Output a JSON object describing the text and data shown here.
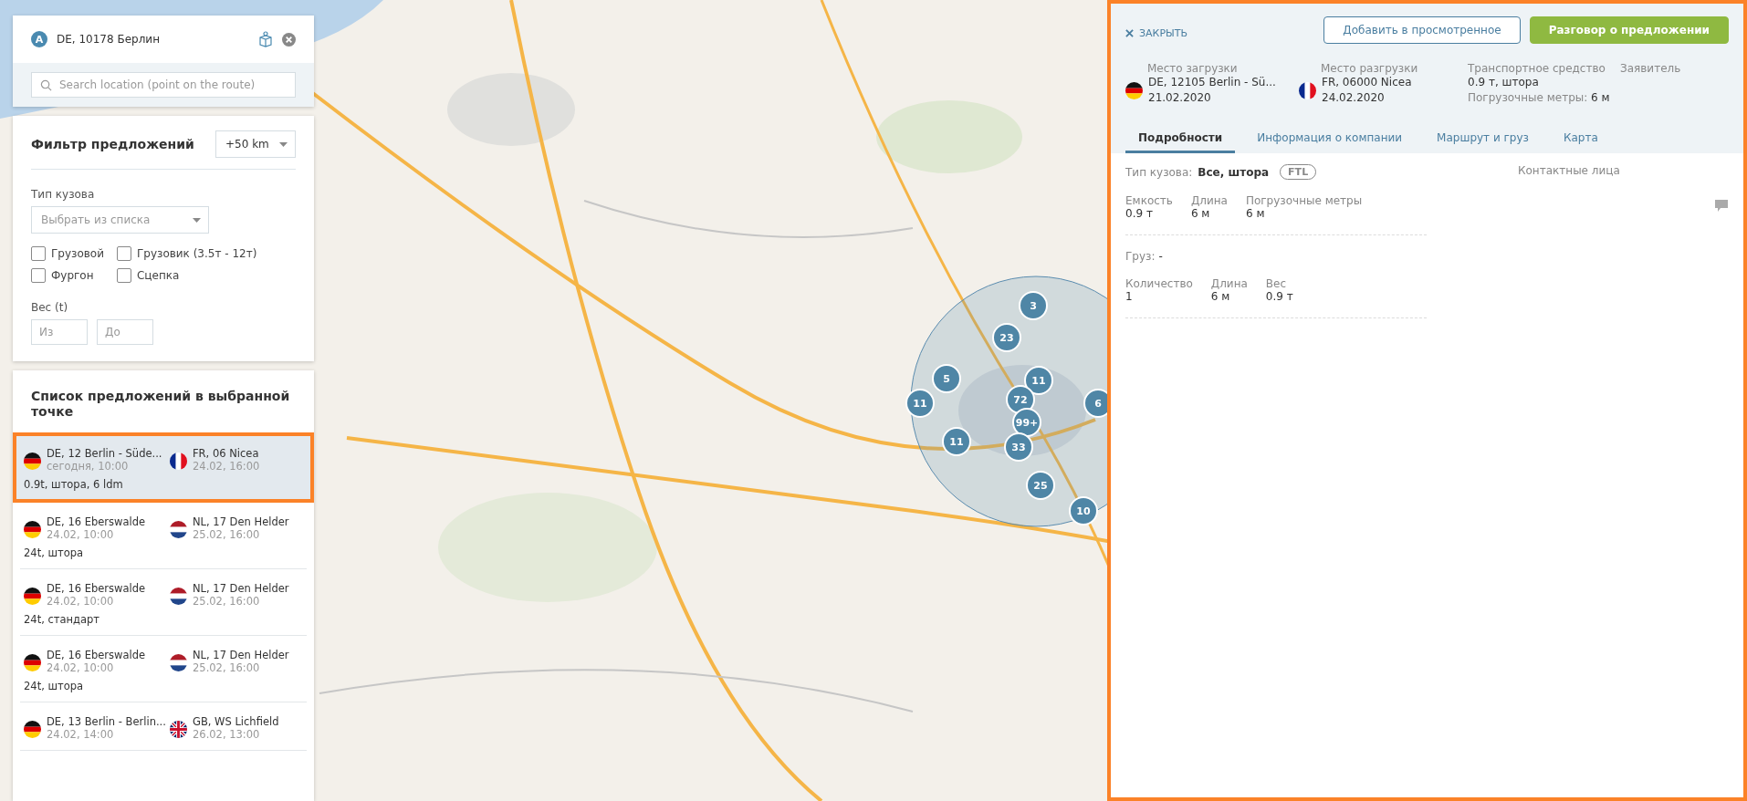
{
  "location": {
    "marker": "A",
    "text": "DE, 10178 Берлин",
    "search_placeholder": "Search location (point on the route)"
  },
  "filter": {
    "title": "Фильтр предложений",
    "radius": "+50 km",
    "body_type_label": "Тип кузова",
    "body_type_placeholder": "Выбрать из списка",
    "vehicle_types": [
      {
        "label": "Грузовой",
        "checked": false
      },
      {
        "label": "Грузовик (3.5т - 12т)",
        "checked": false
      },
      {
        "label": "Фургон",
        "checked": false
      },
      {
        "label": "Сцепка",
        "checked": false
      }
    ],
    "weight_label": "Вес (t)",
    "weight_from_placeholder": "Из",
    "weight_to_placeholder": "До"
  },
  "offers": {
    "title": "Список предложений в выбранной точке",
    "items": [
      {
        "selected": true,
        "from": {
          "kind": "de",
          "place": "DE, 12 Berlin - Süde...",
          "time": "сегодня, 10:00"
        },
        "to": {
          "kind": "fr",
          "place": "FR, 06 Nicea",
          "time": "24.02, 16:00"
        },
        "summary": "0.9t, штора, 6 ldm"
      },
      {
        "selected": false,
        "from": {
          "kind": "de",
          "place": "DE, 16 Eberswalde",
          "time": "24.02, 10:00"
        },
        "to": {
          "kind": "nl",
          "place": "NL, 17 Den Helder",
          "time": "25.02, 16:00"
        },
        "summary": "24t, штора"
      },
      {
        "selected": false,
        "from": {
          "kind": "de",
          "place": "DE, 16 Eberswalde",
          "time": "24.02, 10:00"
        },
        "to": {
          "kind": "nl",
          "place": "NL, 17 Den Helder",
          "time": "25.02, 16:00"
        },
        "summary": "24t, стандарт"
      },
      {
        "selected": false,
        "from": {
          "kind": "de",
          "place": "DE, 16 Eberswalde",
          "time": "24.02, 10:00"
        },
        "to": {
          "kind": "nl",
          "place": "NL, 17 Den Helder",
          "time": "25.02, 16:00"
        },
        "summary": "24t, штора"
      },
      {
        "selected": false,
        "from": {
          "kind": "de",
          "place": "DE, 13 Berlin - Berlin...",
          "time": "24.02, 14:00"
        },
        "to": {
          "kind": "gb",
          "place": "GB, WS Lichfield",
          "time": "26.02, 13:00"
        }
      }
    ]
  },
  "map": {
    "clusters": [
      {
        "label": "3"
      },
      {
        "label": "23"
      },
      {
        "label": "5"
      },
      {
        "label": "11"
      },
      {
        "label": "11"
      },
      {
        "label": "72"
      },
      {
        "label": "99+"
      },
      {
        "label": "11"
      },
      {
        "label": "33"
      },
      {
        "label": "25"
      },
      {
        "label": "10"
      },
      {
        "label": "6"
      }
    ]
  },
  "detail": {
    "close": "ЗАКРЫТЬ",
    "add_button": "Добавить в просмотренное",
    "chat_button": "Разговор о предложении",
    "loading": {
      "label": "Место загрузки",
      "kind": "de",
      "place": "DE, 12105 Berlin - Sü...",
      "date": "21.02.2020"
    },
    "unloading": {
      "label": "Место разгрузки",
      "kind": "fr",
      "place": "FR, 06000 Nicea",
      "date": "24.02.2020"
    },
    "vehicle": {
      "label": "Транспортное средство",
      "value": "0.9 т, штора",
      "ldm_label": "Погрузочные метры:",
      "ldm_value": "6 м"
    },
    "applicant": {
      "label": "Заявитель"
    },
    "tabs": [
      {
        "label": "Подробности",
        "selected": true
      },
      {
        "label": "Информация о компании",
        "selected": false
      },
      {
        "label": "Маршрут и груз",
        "selected": false
      },
      {
        "label": "Карта",
        "selected": false
      }
    ],
    "body_type_label": "Тип кузова:",
    "body_type_value": "Все, штора",
    "body_badge": "FTL",
    "vehicle_specs": [
      {
        "label": "Емкость",
        "value": "0.9 т"
      },
      {
        "label": "Длина",
        "value": "6 м"
      },
      {
        "label": "Погрузочные метры",
        "value": "6 м"
      }
    ],
    "cargo_label": "Груз:",
    "cargo_value": "-",
    "cargo_specs": [
      {
        "label": "Количество",
        "value": "1"
      },
      {
        "label": "Длина",
        "value": "6 м"
      },
      {
        "label": "Вес",
        "value": "0.9 т"
      }
    ],
    "contacts_label": "Контактные лица"
  }
}
